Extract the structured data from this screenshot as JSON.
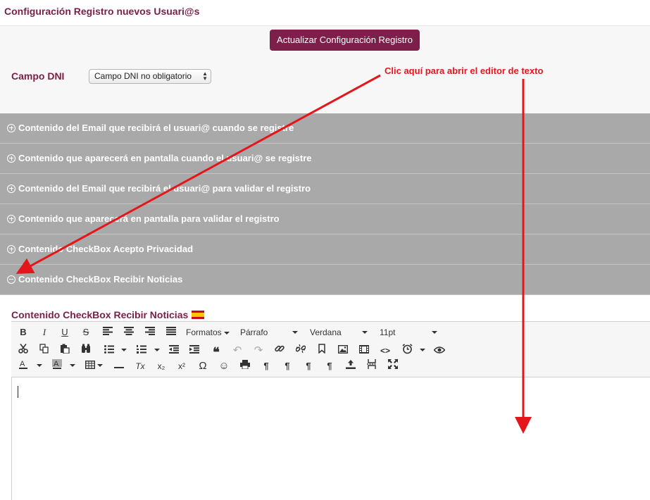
{
  "page": {
    "title": "Configuración Registro nuevos Usuari@s"
  },
  "header": {
    "update_button": "Actualizar Configuración Registro"
  },
  "dni": {
    "label": "Campo DNI",
    "selected": "Campo DNI no obligatorio"
  },
  "annotation": {
    "text": "Clic aquí para abrir el editor de texto",
    "color": "#e4161b"
  },
  "accordion": {
    "items": [
      {
        "label": "Contenido del Email que recibirá el usuari@ cuando se registre",
        "state": "collapsed"
      },
      {
        "label": "Contenido que aparecerá en pantalla cuando el usuari@ se registre",
        "state": "collapsed"
      },
      {
        "label": "Contenido del Email que recibirá el usuari@ para validar el registro",
        "state": "collapsed"
      },
      {
        "label": "Contenido que aparecerá en pantalla para validar el registro",
        "state": "collapsed"
      },
      {
        "label": "Contenido CheckBox Acepto Privacidad",
        "state": "collapsed"
      },
      {
        "label": "Contenido CheckBox Recibir Noticias",
        "state": "expanded"
      }
    ]
  },
  "section": {
    "label": "Contenido CheckBox Recibir Noticias",
    "flag_icon": "spain-flag-icon"
  },
  "editor": {
    "formats_label": "Formatos",
    "block_format": "Párrafo",
    "font_family": "Verdana",
    "font_size": "11pt",
    "glyphs": {
      "bold": "B",
      "italic": "I",
      "underline": "U",
      "strike": "S",
      "quote": "❝",
      "undo": "↶",
      "redo": "↷",
      "code": "<>",
      "clear_format": "Tx",
      "subscript": "x₂",
      "superscript": "x²",
      "omega": "Ω",
      "smiley": "☺",
      "pilcrow": "¶"
    }
  },
  "colors": {
    "brand": "#7d1f4a",
    "accordion_bg": "#a9a9a9",
    "arrow": "#e4161b"
  }
}
